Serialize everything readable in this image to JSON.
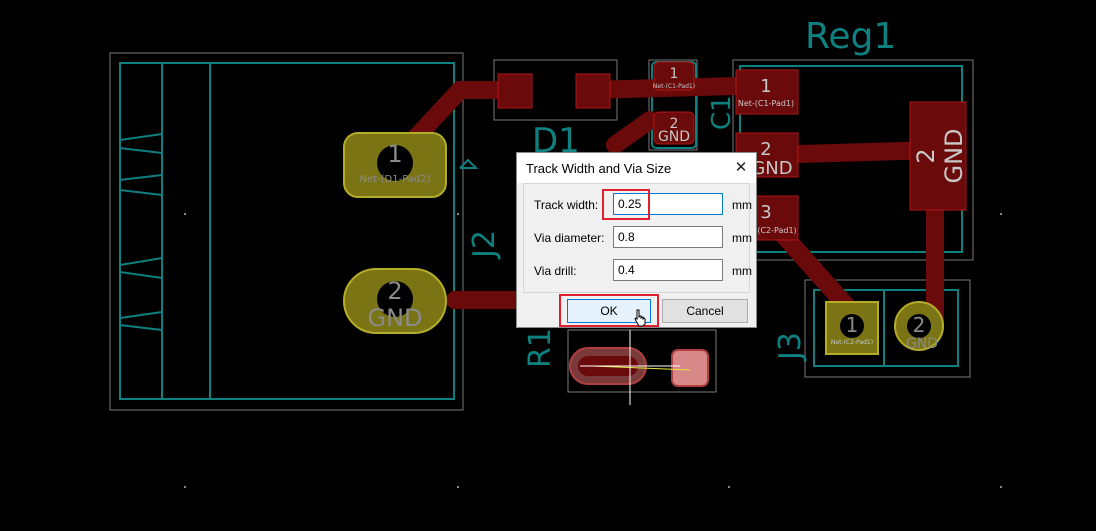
{
  "board": {
    "refs": {
      "reg1": "Reg1",
      "d1": "D1",
      "j2": "J2",
      "c1": "C1",
      "j3": "J3",
      "r1": "R1"
    },
    "pads": {
      "j2_pad1_num": "1",
      "j2_pad1_net": "Net-(D1-Pad2)",
      "j2_pad2_num": "2",
      "j2_pad2_net": "GND",
      "c1_pad1_num": "1",
      "c1_pad1_net": "Net-(C1-Pad1)",
      "c1_pad2_num": "2",
      "c1_pad2_net": "GND",
      "reg_pad1_num": "1",
      "reg_pad1_net": "Net-(C1-Pad1)",
      "reg_pad2_num": "2",
      "reg_pad2_net": "GND",
      "reg_pad3_num": "3",
      "reg_pad3_net": "(C2-Pad1)",
      "reg_tab_num": "2",
      "reg_tab_net": "GND",
      "j3_pad1_num": "1",
      "j3_pad1_net": "Net-(C2-Pad1)",
      "j3_pad2_num": "2",
      "j3_pad2_net": "GND"
    },
    "colors": {
      "outline": "#0f8080",
      "silk": "#6e6e6e",
      "track": "#6a0a0a",
      "pad_copper": "#7a7414",
      "pad_text": "#c8c8c8"
    }
  },
  "dialog": {
    "title": "Track Width and Via Size",
    "close_glyph": "✕",
    "track_width_label": "Track width:",
    "track_width_value": "0.25",
    "via_diameter_label": "Via diameter:",
    "via_diameter_value": "0.8",
    "via_drill_label": "Via drill:",
    "via_drill_value": "0.4",
    "unit": "mm",
    "ok_label": "OK",
    "cancel_label": "Cancel"
  }
}
